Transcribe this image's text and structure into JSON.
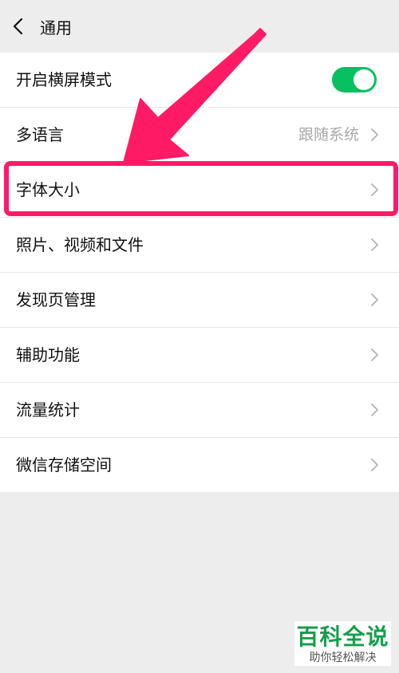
{
  "header": {
    "title": "通用"
  },
  "settings": {
    "rows": [
      {
        "label": "开启横屏模式"
      },
      {
        "label": "多语言",
        "value": "跟随系统"
      },
      {
        "label": "字体大小"
      },
      {
        "label": "照片、视频和文件"
      },
      {
        "label": "发现页管理"
      },
      {
        "label": "辅助功能"
      },
      {
        "label": "流量统计"
      },
      {
        "label": "微信存储空间"
      }
    ],
    "landscape_toggle": {
      "on": true,
      "color": "#07c160"
    }
  },
  "annotation": {
    "highlight_color": "#ff1a66"
  },
  "watermark": {
    "title": "百科全说",
    "subtitle": "助你轻松解决"
  }
}
